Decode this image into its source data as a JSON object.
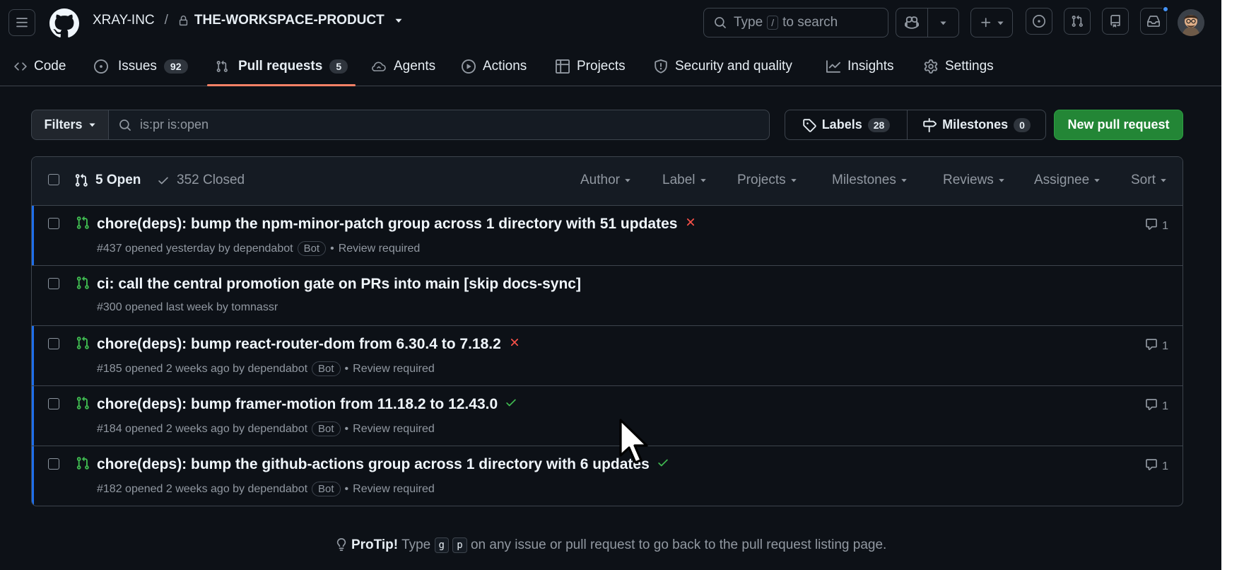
{
  "header": {
    "org": "XRAY-INC",
    "separator": "/",
    "repo": "THE-WORKSPACE-PRODUCT",
    "search_prefix": "Type",
    "search_key": "/",
    "search_suffix": "to search"
  },
  "nav": {
    "code": "Code",
    "issues": "Issues",
    "issues_count": "92",
    "pulls": "Pull requests",
    "pulls_count": "5",
    "agents": "Agents",
    "actions": "Actions",
    "projects": "Projects",
    "security": "Security and quality",
    "insights": "Insights",
    "settings": "Settings"
  },
  "toolbar": {
    "filters": "Filters",
    "query": "is:pr is:open",
    "labels": "Labels",
    "labels_count": "28",
    "milestones": "Milestones",
    "milestones_count": "0",
    "new_pr": "New pull request"
  },
  "list_header": {
    "open": "5 Open",
    "closed": "352 Closed",
    "filters": [
      "Author",
      "Label",
      "Projects",
      "Milestones",
      "Reviews",
      "Assignee",
      "Sort"
    ]
  },
  "pulls": [
    {
      "title": "chore(deps): bump the npm-minor-patch group across 1 directory with 51 updates",
      "meta": "#437 opened yesterday by dependabot",
      "bot": "Bot",
      "review": "Review required",
      "comments": "1",
      "status": "fail"
    },
    {
      "title": "ci: call the central promotion gate on PRs into main [skip docs-sync]",
      "meta": "#300 opened last week by tomnassr",
      "bot": "",
      "review": "",
      "comments": "",
      "status": "none"
    },
    {
      "title": "chore(deps): bump react-router-dom from 6.30.4 to 7.18.2",
      "meta": "#185 opened 2 weeks ago by dependabot",
      "bot": "Bot",
      "review": "Review required",
      "comments": "1",
      "status": "fail"
    },
    {
      "title": "chore(deps): bump framer-motion from 11.18.2 to 12.43.0",
      "meta": "#184 opened 2 weeks ago by dependabot",
      "bot": "Bot",
      "review": "Review required",
      "comments": "1",
      "status": "success"
    },
    {
      "title": "chore(deps): bump the github-actions group across 1 directory with 6 updates",
      "meta": "#182 opened 2 weeks ago by dependabot",
      "bot": "Bot",
      "review": "Review required",
      "comments": "1",
      "status": "success"
    }
  ],
  "protip": {
    "label": "ProTip!",
    "type": "Type",
    "key1": "g",
    "key2": "p",
    "rest": "on any issue or pull request to go back to the pull request listing page."
  },
  "colors": {
    "background": "#0d1117",
    "accent_underline": "#f78166",
    "primary_button": "#238636",
    "open_icon": "#3fb950",
    "fail": "#f85149",
    "unread_bar": "#1f6feb"
  }
}
